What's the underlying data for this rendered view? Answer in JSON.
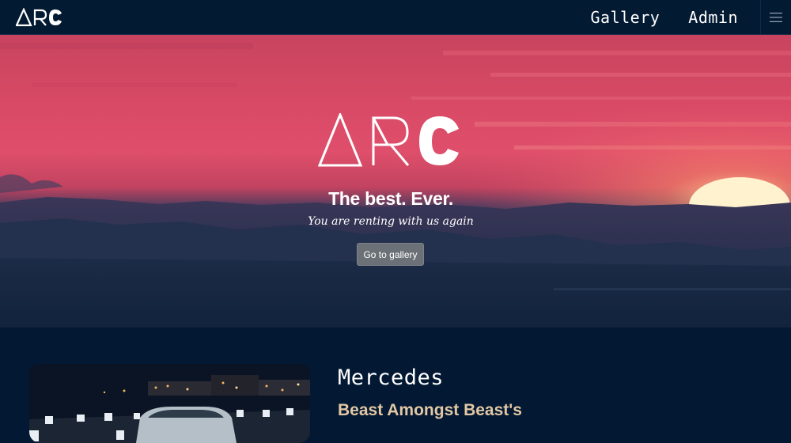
{
  "navbar": {
    "brand_icon": "arc-logo",
    "links": [
      {
        "label": "Gallery"
      },
      {
        "label": "Admin"
      }
    ],
    "menu_icon": "hamburger-menu-icon"
  },
  "hero": {
    "logo_icon": "arc-logo",
    "title": "The best. Ever.",
    "subtitle": "You are renting with us again",
    "button_label": "Go to gallery",
    "background_image": "sunset-over-mountains"
  },
  "featured_car": {
    "image": "mercedes-car-night-photo",
    "name": "Mercedes",
    "tagline": "Beast Amongst Beast's"
  },
  "colors": {
    "nav_bg": "#031a33",
    "page_bg": "#021833",
    "button_bg": "#6b7176",
    "tagline": "#e3c8a4",
    "text": "#ffffff"
  }
}
